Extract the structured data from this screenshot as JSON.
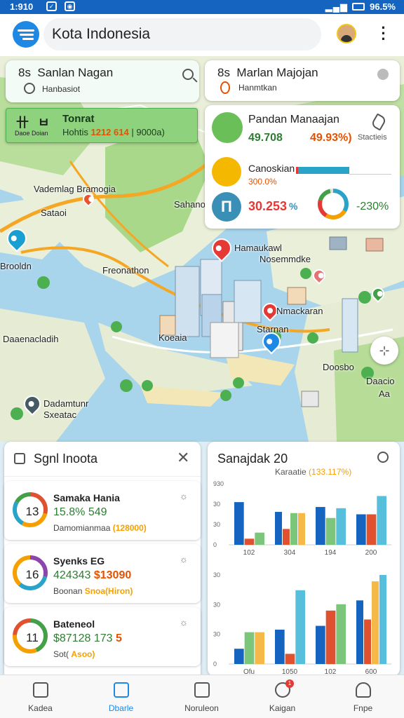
{
  "status": {
    "time": "1:910",
    "right": "96.5%",
    "signal": "▂▄▆",
    "icon1": "✓",
    "icon2": "◉"
  },
  "app": {
    "search_text": "Kota Indonesia"
  },
  "map": {
    "labels": [
      "Vademlag Bramogia",
      "Sataoi",
      "Sahanol",
      "Brooldn",
      "Freonathon",
      "Hamaukawl",
      "Nosemmdke",
      "Nmackaran",
      "Starnan",
      "Koeaia",
      "Daaenacladih",
      "Doosbo",
      "Daacio",
      "Aa",
      "Dadamtunr",
      "Sxeatac"
    ]
  },
  "search_card": {
    "title": "Sanlan Nagan",
    "subtitle": "Hanbasiot",
    "prefix": "8s"
  },
  "green_card": {
    "icon_text": "卄 ㅂ",
    "icon_label": "Daoe Doian",
    "title": "Tonrat",
    "value_prefix": "Hohtis",
    "value_highlight": "1212 614",
    "value_suffix": "| 9000a)"
  },
  "route_card": {
    "prefix": "8s",
    "title": "Marlan Majojan",
    "subtitle": "Hanmtkan"
  },
  "stats_card": {
    "row1_title": "Pandan Manaajan",
    "row1_value_a": "49.708",
    "row1_value_b": "49.93%)",
    "row1_value_c": "Stactieis",
    "row2_title": "Canoskian",
    "row2_sub": "300.0%",
    "row3_value_a": "30.253",
    "row3_value_b": "%",
    "row3_value_c": "-230%",
    "icon3_glyph": "Π"
  },
  "list_card": {
    "title": "Sgnl Inoota",
    "items": [
      {
        "rank": "13",
        "name": "Samaka Hania",
        "value": "15.8% 549",
        "meta": "Damomianmaa",
        "meta_highlight": "(128000)"
      },
      {
        "rank": "16",
        "name": "Syenks EG",
        "value": "424343",
        "value_highlight": "$13090",
        "meta": "Boonan",
        "meta_highlight": "Snoa(Hiron)"
      },
      {
        "rank": "11",
        "name": "Bateneol",
        "value": "$87128 173",
        "value_highlight": "5",
        "meta": "Sot(",
        "meta_highlight": "Asoo)"
      }
    ]
  },
  "chart_card": {
    "title": "Sanajdak 20",
    "subtitle_prefix": "Karaatie",
    "subtitle_highlight": "(133.117%)"
  },
  "chart_data": [
    {
      "type": "bar",
      "categories": [
        "102",
        "304",
        "194",
        "200"
      ],
      "series": [
        {
          "values": [
            35,
            27,
            31,
            25
          ],
          "color": "#1565c0"
        },
        {
          "values": [
            5,
            13,
            0,
            25
          ],
          "color": "#e0522f"
        },
        {
          "values": [
            10,
            26,
            22,
            0
          ],
          "color": "#7bc67a"
        },
        {
          "values": [
            0,
            26,
            0,
            0
          ],
          "color": "#f5b94a"
        },
        {
          "values": [
            0,
            0,
            30,
            40
          ],
          "color": "#56bfdc"
        }
      ],
      "yticks": [
        "0",
        "30",
        "30",
        "930"
      ],
      "ylim": [
        0,
        50
      ]
    },
    {
      "type": "bar",
      "categories": [
        "Ofu",
        "1050",
        "102",
        "600"
      ],
      "series": [
        {
          "values": [
            12,
            27,
            30,
            50
          ],
          "color": "#1565c0"
        },
        {
          "values": [
            0,
            8,
            42,
            35
          ],
          "color": "#e0522f"
        },
        {
          "values": [
            25,
            0,
            47,
            0
          ],
          "color": "#7bc67a"
        },
        {
          "values": [
            25,
            0,
            0,
            65
          ],
          "color": "#f5b94a"
        },
        {
          "values": [
            0,
            58,
            0,
            70
          ],
          "color": "#56bfdc"
        }
      ],
      "yticks": [
        "0",
        "30",
        "30",
        "30"
      ],
      "ylim": [
        0,
        70
      ]
    }
  ],
  "nav": [
    {
      "label": "Kadea",
      "active": false
    },
    {
      "label": "Dbarle",
      "active": true
    },
    {
      "label": "Noruleon",
      "active": false
    },
    {
      "label": "Kaigan",
      "active": false,
      "badge": "1"
    },
    {
      "label": "Fnpe",
      "active": false
    }
  ],
  "colors": {
    "brand": "#1565c0",
    "accent": "#1e88e5",
    "green": "#2e7d32",
    "orange": "#e65100"
  }
}
